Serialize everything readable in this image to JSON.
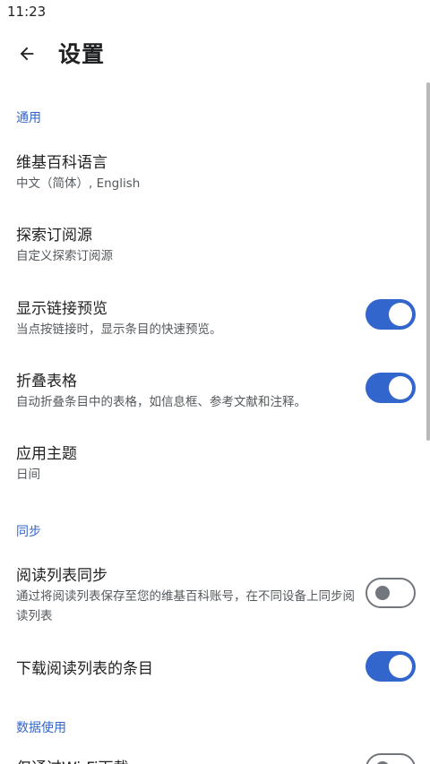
{
  "status_bar": {
    "time": "11:23"
  },
  "app_bar": {
    "back_icon": "arrow-left-icon",
    "title": "设置"
  },
  "sections": {
    "general": {
      "header": "通用",
      "language": {
        "title": "维基百科语言",
        "summary": "中文（简体）, English"
      },
      "explore_feed": {
        "title": "探索订阅源",
        "summary": "自定义探索订阅源"
      },
      "link_previews": {
        "title": "显示链接预览",
        "summary": "当点按链接时，显示条目的快速预览。",
        "enabled": true
      },
      "collapse_tables": {
        "title": "折叠表格",
        "summary": "自动折叠条目中的表格，如信息框、参考文献和注释。",
        "enabled": true
      },
      "app_theme": {
        "title": "应用主题",
        "summary": "日间"
      }
    },
    "sync": {
      "header": "同步",
      "reading_list_sync": {
        "title": "阅读列表同步",
        "summary": "通过将阅读列表保存至您的维基百科账号，在不同设备上同步阅读列表",
        "enabled": false
      },
      "download_reading_list": {
        "title": "下载阅读列表的条目",
        "enabled": true
      }
    },
    "data_usage": {
      "header": "数据使用",
      "wifi_only": {
        "title": "仅通过Wi-Fi下载",
        "enabled": false
      }
    }
  },
  "colors": {
    "accent": "#3366cc",
    "switch_off": "#72777d",
    "text_primary": "#202122",
    "text_secondary": "#54595d"
  }
}
